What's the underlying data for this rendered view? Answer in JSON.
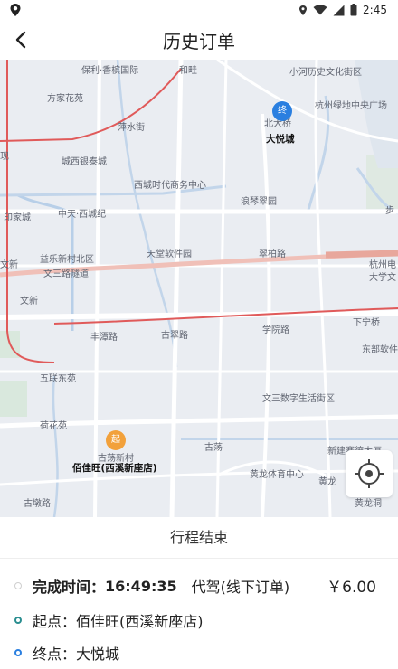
{
  "status_bar": {
    "time": "2:45"
  },
  "header": {
    "title": "历史订单"
  },
  "map": {
    "labels": [
      "保利·香槟国际",
      "和畦",
      "小河历史文化街区",
      "方家花苑",
      "萍水街",
      "杭州绿地中央广场",
      "北大桥",
      "大悦城",
      "现",
      "城西银泰城",
      "西城时代商务中心",
      "浪琴翠园",
      "中天·西城纪",
      "印家城",
      "步",
      "天堂软件园",
      "翠柏路",
      "益乐新村北区",
      "文新",
      "杭州电",
      "大学文",
      "文三路隧道",
      "文新",
      "古翠路",
      "学院路",
      "下宁桥",
      "丰潭路",
      "东部软件",
      "五联东苑",
      "文三数字生活街区",
      "荷花苑",
      "古荡",
      "古荡新村",
      "新建赛德大厦",
      "佰佳旺(西溪新座店)",
      "黄龙体育中心",
      "古墩路",
      "黄龙",
      "黄龙洞"
    ],
    "start_marker": "起",
    "end_marker": "终"
  },
  "trip": {
    "status": "行程结束"
  },
  "order": {
    "time_label": "完成时间：",
    "time_value": "16:49:35",
    "service": "代驾(线下订单)",
    "price": "￥6.00",
    "start_label": "起点：",
    "start_value": "佰佳旺(西溪新座店)",
    "end_label": "终点：",
    "end_value": "大悦城"
  },
  "colors": {
    "route_red": "#e05a5a",
    "start_marker": "#f2a13b",
    "end_marker": "#2a7fe0",
    "teal": "#2a8e90"
  }
}
